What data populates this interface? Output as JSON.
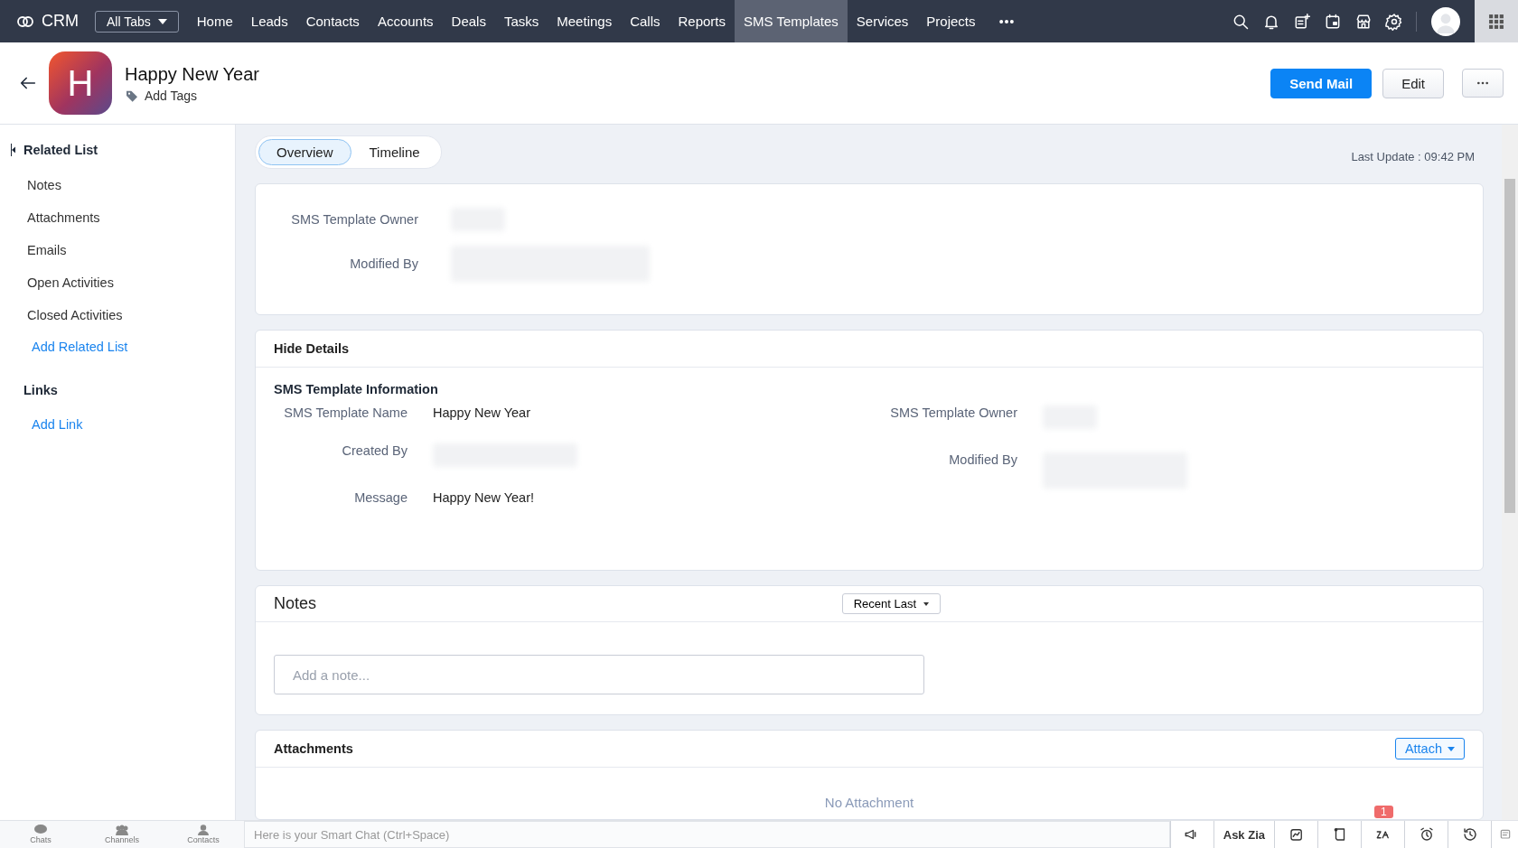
{
  "topbar": {
    "brand": "CRM",
    "all_tabs": "All Tabs",
    "nav": [
      {
        "label": "Home",
        "selected": false
      },
      {
        "label": "Leads",
        "selected": false
      },
      {
        "label": "Contacts",
        "selected": false
      },
      {
        "label": "Accounts",
        "selected": false
      },
      {
        "label": "Deals",
        "selected": false
      },
      {
        "label": "Tasks",
        "selected": false
      },
      {
        "label": "Meetings",
        "selected": false
      },
      {
        "label": "Calls",
        "selected": false
      },
      {
        "label": "Reports",
        "selected": false
      },
      {
        "label": "SMS Templates",
        "selected": true
      },
      {
        "label": "Services",
        "selected": false
      },
      {
        "label": "Projects",
        "selected": false
      }
    ]
  },
  "header": {
    "avatar_letter": "H",
    "title": "Happy New Year",
    "add_tags": "Add Tags",
    "buttons": [
      {
        "label": "Send Mail",
        "kind": "primary"
      },
      {
        "label": "Edit",
        "kind": "secondary"
      }
    ]
  },
  "sidebar": {
    "sections": [
      {
        "title": "Related List",
        "items": [
          {
            "label": "Notes",
            "kind": "item"
          },
          {
            "label": "Attachments",
            "kind": "item"
          },
          {
            "label": "Emails",
            "kind": "item"
          },
          {
            "label": "Open Activities",
            "kind": "item"
          },
          {
            "label": "Closed Activities",
            "kind": "item"
          },
          {
            "label": "Add Related List",
            "kind": "link"
          }
        ]
      },
      {
        "title": "Links",
        "items": [
          {
            "label": "Add Link",
            "kind": "link"
          }
        ]
      }
    ]
  },
  "tabs": [
    {
      "label": "Overview",
      "selected": true
    },
    {
      "label": "Timeline",
      "selected": false
    }
  ],
  "last_update": "Last Update : 09:42 PM",
  "summary": [
    {
      "label": "SMS Template Owner"
    },
    {
      "label": "Modified By"
    }
  ],
  "details": {
    "toggle": "Hide Details",
    "section": "SMS Template Information",
    "left": [
      {
        "label": "SMS Template Name",
        "value": "Happy New Year"
      },
      {
        "label": "Created By"
      },
      {
        "label": "Message",
        "value": "Happy New Year!"
      }
    ],
    "right": [
      {
        "label": "SMS Template Owner"
      },
      {
        "label": "Modified By"
      }
    ]
  },
  "notes": {
    "title": "Notes",
    "sort": "Recent Last",
    "placeholder": "Add a note..."
  },
  "attachments": {
    "title": "Attachments",
    "attach": "Attach",
    "empty": "No Attachment"
  },
  "bottombar": {
    "apps": [
      "Chats",
      "Channels",
      "Contacts"
    ],
    "smart_chat": {
      "placeholder": "Here is your Smart Chat (Ctrl+Space)"
    },
    "ask_zia": "Ask Zia",
    "badge": "1"
  }
}
